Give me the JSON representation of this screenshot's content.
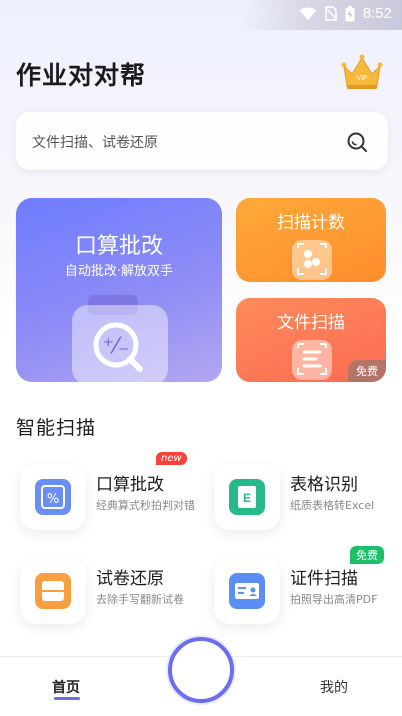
{
  "status": {
    "time": "8:52"
  },
  "app": {
    "title": "作业对对帮",
    "vip_label": "VIP"
  },
  "search": {
    "placeholder": "文件扫描、试卷还原"
  },
  "feature_cards": {
    "main": {
      "title": "口算批改",
      "subtitle": "自动批改·解放双手"
    },
    "count": {
      "title": "扫描计数"
    },
    "file": {
      "title": "文件扫描",
      "badge": "免费"
    }
  },
  "section": {
    "title": "智能扫描"
  },
  "tools": [
    {
      "name": "口算批改",
      "desc": "经典算式秒拍判对错",
      "badge": "new"
    },
    {
      "name": "表格识别",
      "desc": "纸质表格转Excel",
      "badge": ""
    },
    {
      "name": "试卷还原",
      "desc": "去除手写翻新试卷",
      "badge": ""
    },
    {
      "name": "证件扫描",
      "desc": "拍照导出高清PDF",
      "badge": "免费"
    }
  ],
  "nav": {
    "home": "首页",
    "mine": "我的"
  },
  "colors": {
    "accent": "#6d6df0",
    "orange": "#ff8d2c",
    "red": "#fb6b54",
    "new_badge": "#f5453a",
    "free_badge": "#1fbe69"
  }
}
